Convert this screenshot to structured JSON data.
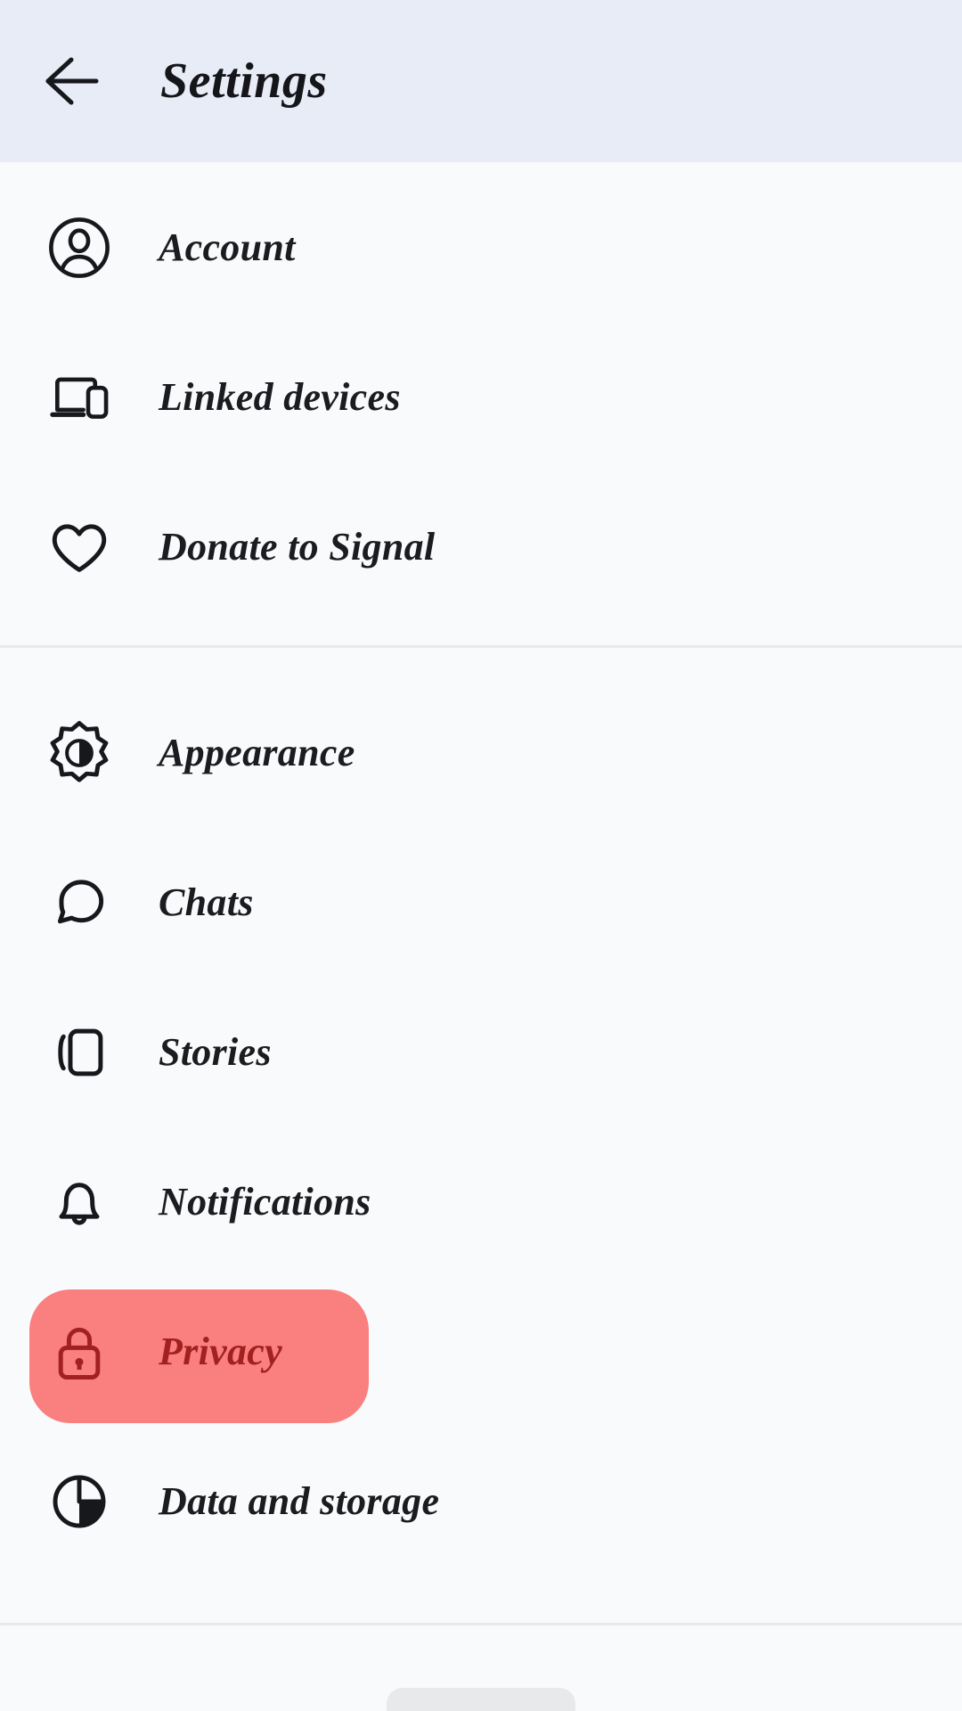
{
  "header": {
    "title": "Settings",
    "back_icon": "arrow-left-icon",
    "background_color": "#e8ecf7"
  },
  "theme": {
    "page_background": "#f9fafc",
    "text_color": "#1b1c1f",
    "selected_pill_color": "#fa7f7f",
    "selected_text_color": "#a32020",
    "divider_color": "#e7e9ec"
  },
  "sections": [
    {
      "id": "account-section",
      "items": [
        {
          "id": "account",
          "label": "Account",
          "icon": "person-circle-icon",
          "selected": false
        },
        {
          "id": "linked-devices",
          "label": "Linked devices",
          "icon": "laptop-phone-icon",
          "selected": false
        },
        {
          "id": "donate",
          "label": "Donate to Signal",
          "icon": "heart-icon",
          "selected": false
        }
      ]
    },
    {
      "id": "app-settings-section",
      "items": [
        {
          "id": "appearance",
          "label": "Appearance",
          "icon": "brightness-icon",
          "selected": false
        },
        {
          "id": "chats",
          "label": "Chats",
          "icon": "chat-bubble-icon",
          "selected": false
        },
        {
          "id": "stories",
          "label": "Stories",
          "icon": "stories-cards-icon",
          "selected": false
        },
        {
          "id": "notifications",
          "label": "Notifications",
          "icon": "bell-icon",
          "selected": false
        },
        {
          "id": "privacy",
          "label": "Privacy",
          "icon": "lock-icon",
          "selected": true
        },
        {
          "id": "data-and-storage",
          "label": "Data and storage",
          "icon": "pie-chart-icon",
          "selected": false
        }
      ]
    }
  ],
  "bottom_peek": {
    "name": "bottom-sheet-peek",
    "color": "#e8e9eb"
  }
}
